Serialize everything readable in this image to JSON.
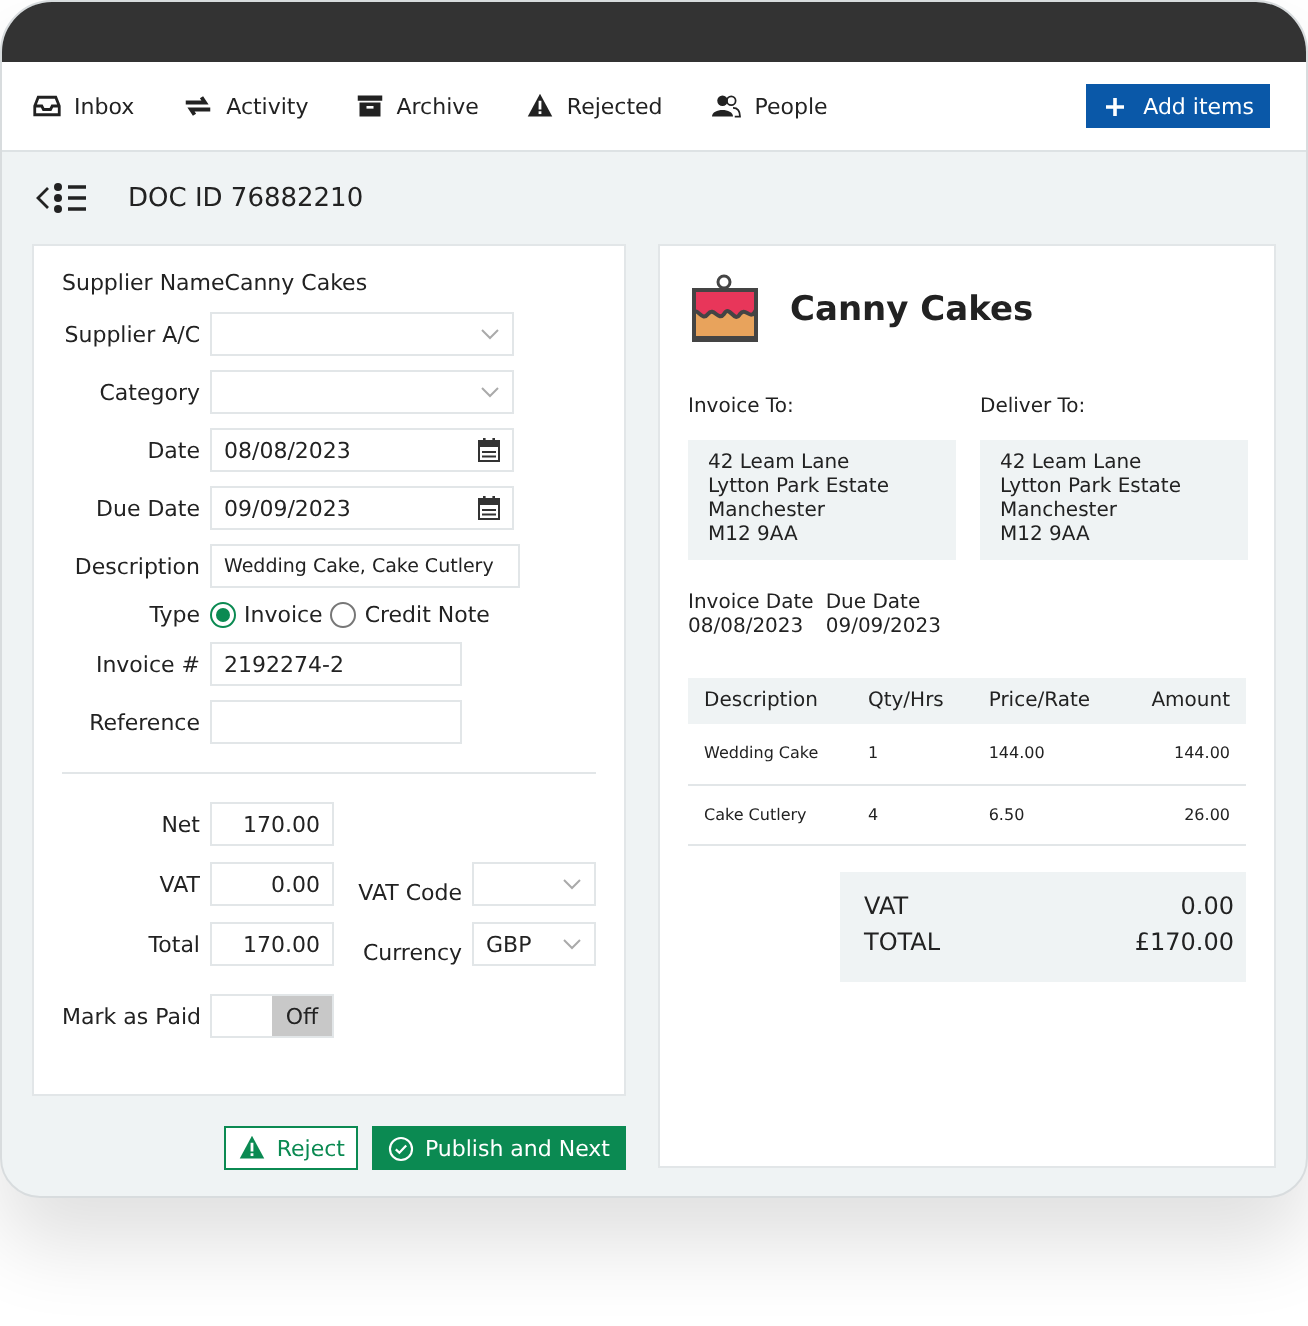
{
  "nav": {
    "items": [
      {
        "label": "Inbox",
        "kind": "inbox"
      },
      {
        "label": "Activity",
        "kind": "activity"
      },
      {
        "label": "Archive",
        "kind": "archive"
      },
      {
        "label": "Rejected",
        "kind": "warning"
      },
      {
        "label": "People",
        "kind": "people"
      }
    ],
    "add_button": "Add items"
  },
  "doc": {
    "title": "DOC ID 76882210"
  },
  "form": {
    "supplier_label": "Supplier Name",
    "supplier_value": "Canny Cakes",
    "fields": [
      {
        "kind": "select",
        "label": "Supplier A/C"
      },
      {
        "kind": "select",
        "label": "Category"
      },
      {
        "kind": "date",
        "label": "Date",
        "value": "08/08/2023"
      },
      {
        "kind": "date",
        "label": "Due Date",
        "value": "09/09/2023"
      },
      {
        "kind": "memo",
        "label": "Description",
        "value": "Wedding Cake, Cake Cutlery"
      },
      {
        "kind": "radio",
        "label": "Type",
        "options": [
          {
            "label": "Invoice",
            "selected": true
          },
          {
            "label": "Credit Note",
            "selected": false
          }
        ]
      },
      {
        "kind": "text",
        "label": "Invoice #",
        "value": "2192274-2"
      },
      {
        "kind": "text",
        "label": "Reference"
      }
    ],
    "amounts": [
      {
        "label": "Net",
        "value": "170.00"
      },
      {
        "label": "VAT",
        "value": "0.00",
        "side": {
          "label": "VAT Code"
        }
      },
      {
        "label": "Total",
        "value": "170.00",
        "side": {
          "label": "Currency",
          "value": "GBP"
        }
      }
    ],
    "mark_paid": {
      "label": "Mark as Paid",
      "on": false,
      "state_label": "Off"
    }
  },
  "actions": {
    "reject": "Reject",
    "publish": "Publish and Next"
  },
  "invoice": {
    "company": "Canny Cakes",
    "addresses": [
      {
        "heading": "Invoice To:",
        "lines": [
          "42 Leam Lane",
          "Lytton Park Estate",
          "Manchester",
          "M12 9AA"
        ]
      },
      {
        "heading": "Deliver To:",
        "lines": [
          "42 Leam Lane",
          "Lytton Park Estate",
          "Manchester",
          "M12 9AA"
        ]
      }
    ],
    "dates": [
      {
        "label": "Invoice Date",
        "value": "08/08/2023"
      },
      {
        "label": "Due Date",
        "value": "09/09/2023"
      }
    ],
    "columns": [
      "Description",
      "Qty/Hrs",
      "Price/Rate",
      "Amount"
    ],
    "rows": [
      [
        "Wedding Cake",
        "1",
        "144.00",
        "144.00"
      ],
      [
        "Cake Cutlery",
        "4",
        "6.50",
        "26.00"
      ]
    ],
    "summary": [
      {
        "label": "VAT",
        "value": "0.00"
      },
      {
        "label": "TOTAL",
        "value": "£170.00"
      }
    ]
  }
}
